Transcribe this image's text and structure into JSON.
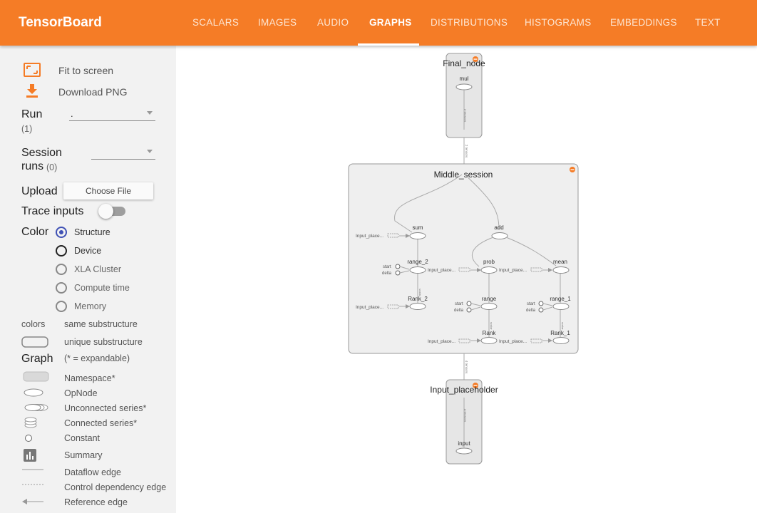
{
  "header": {
    "brand": "TensorBoard",
    "tabs": [
      "SCALARS",
      "IMAGES",
      "AUDIO",
      "GRAPHS",
      "DISTRIBUTIONS",
      "HISTOGRAMS",
      "EMBEDDINGS",
      "TEXT"
    ],
    "active_tab": "GRAPHS",
    "color": "#f57c26"
  },
  "sidebar": {
    "fit_label": "Fit to screen",
    "download_label": "Download PNG",
    "run_label": "Run",
    "run_count": "(1)",
    "run_value": ".",
    "session_label_1": "Session",
    "session_label_2": "runs",
    "session_count": "(0)",
    "session_value": "",
    "upload_label": "Upload",
    "choose_file": "Choose File",
    "trace_label": "Trace inputs",
    "trace_on": false,
    "color_label": "Color",
    "color_options": [
      "Structure",
      "Device",
      "XLA Cluster",
      "Compute time",
      "Memory"
    ],
    "color_selected": "Structure",
    "colors_label": "colors",
    "same_sub": "same substructure",
    "unique_sub": "unique substructure",
    "graph_label": "Graph",
    "expandable_note": "(* = expandable)",
    "legend": [
      "Namespace*",
      "OpNode",
      "Unconnected series*",
      "Connected series*",
      "Constant",
      "Summary",
      "Dataflow edge",
      "Control dependency edge",
      "Reference edge"
    ]
  },
  "graph": {
    "final_node": {
      "name": "Final_node",
      "op": "mul",
      "edge": "2 tensors"
    },
    "middle": {
      "name": "Middle_session",
      "nodes": {
        "sum": "sum",
        "add": "add",
        "range_2": "range_2",
        "prob": "prob",
        "mean": "mean",
        "rank_2": "Rank_2",
        "range": "range",
        "range_1": "range_1",
        "rank": "Rank",
        "rank_1": "Rank_1"
      },
      "placeholder_stub": "Input_place...",
      "start": "start",
      "delta": "delta",
      "scalar": "scalar",
      "mid_edge": "2 tensors",
      "bottom_edge": "4 tensors"
    },
    "input": {
      "name": "Input_placeholder",
      "op": "input",
      "edge": "4 tensors"
    }
  }
}
